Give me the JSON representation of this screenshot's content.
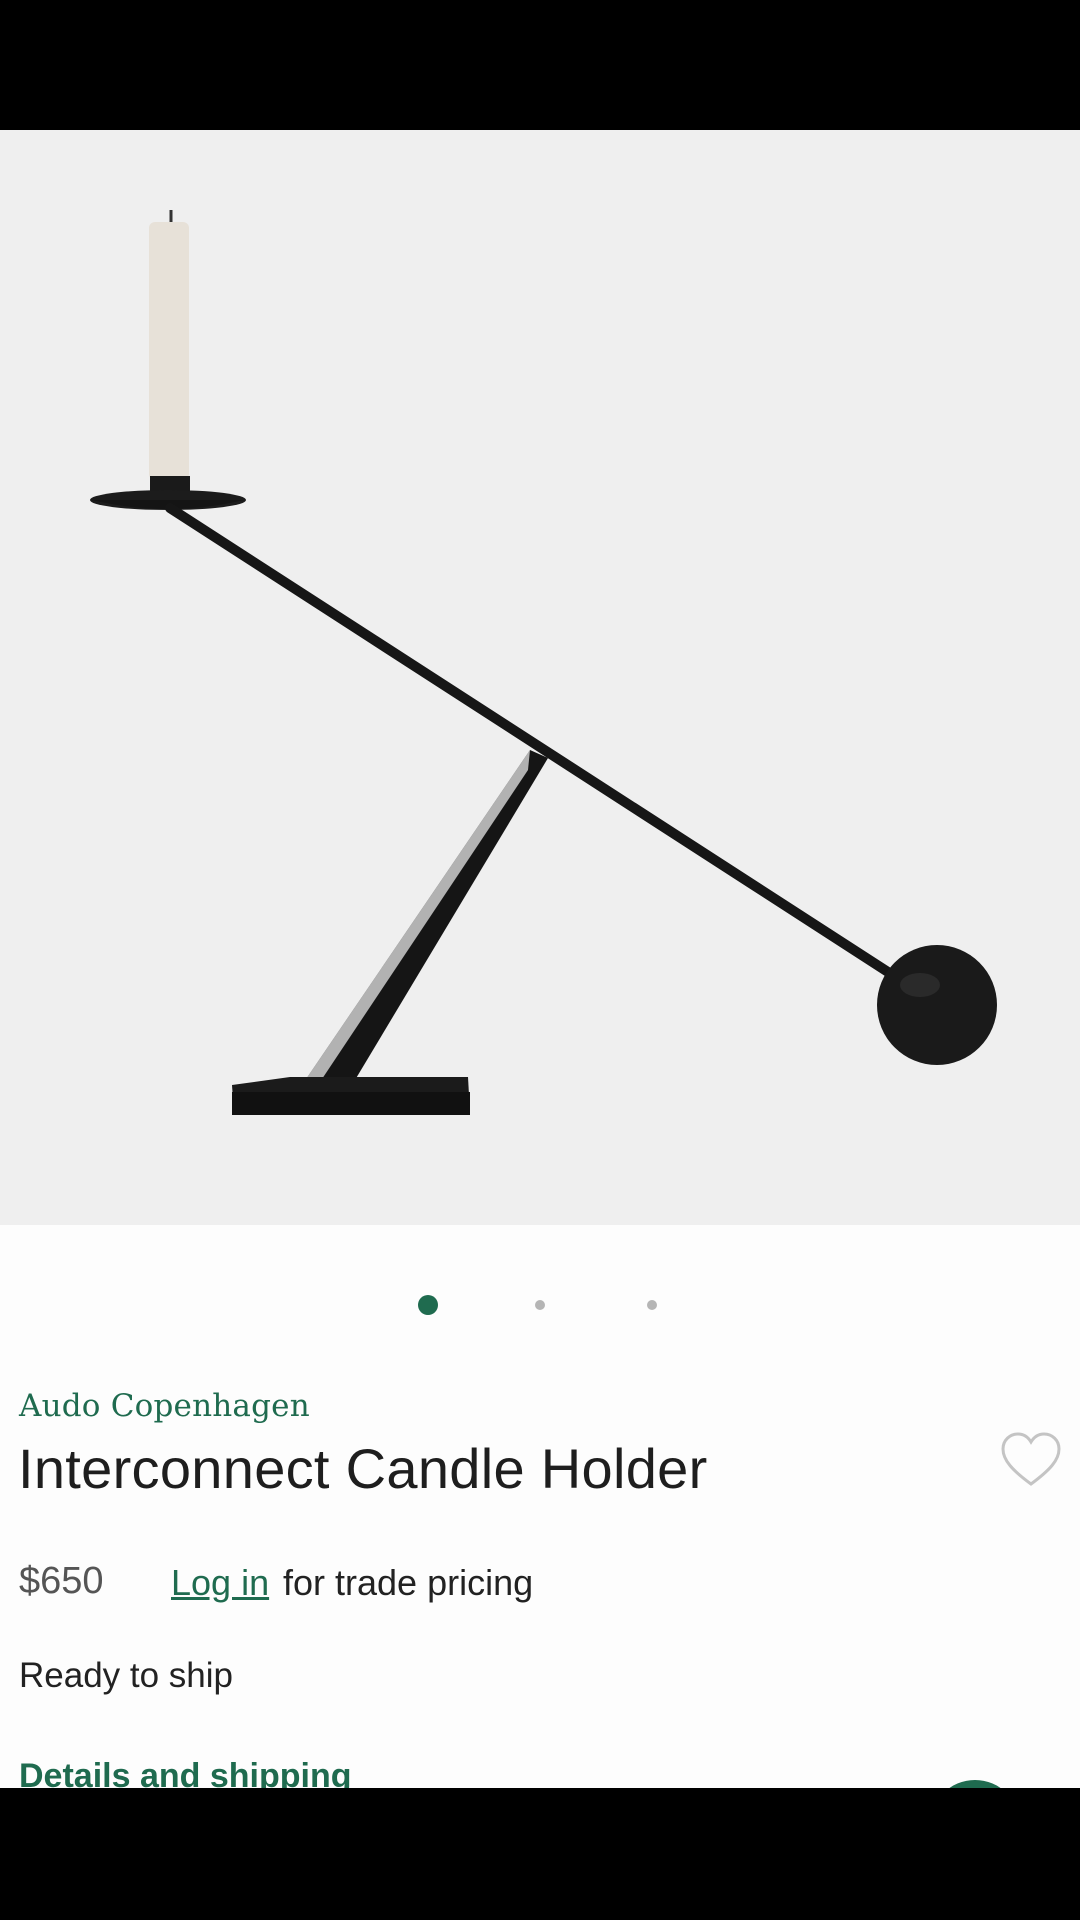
{
  "product": {
    "brand": "Audo Copenhagen",
    "title": "Interconnect Candle Holder",
    "price": "$650",
    "login_link": "Log in",
    "trade_text": "for trade pricing",
    "availability": "Ready to ship",
    "details_link": "Details and shipping"
  },
  "gallery": {
    "current_image": 1,
    "total_images": 3
  },
  "icons": {
    "favorite": "heart-outline-icon"
  },
  "colors": {
    "accent": "#1f6b4f",
    "hero_background": "#efefef",
    "inactive_dot": "#b5b5b5"
  }
}
